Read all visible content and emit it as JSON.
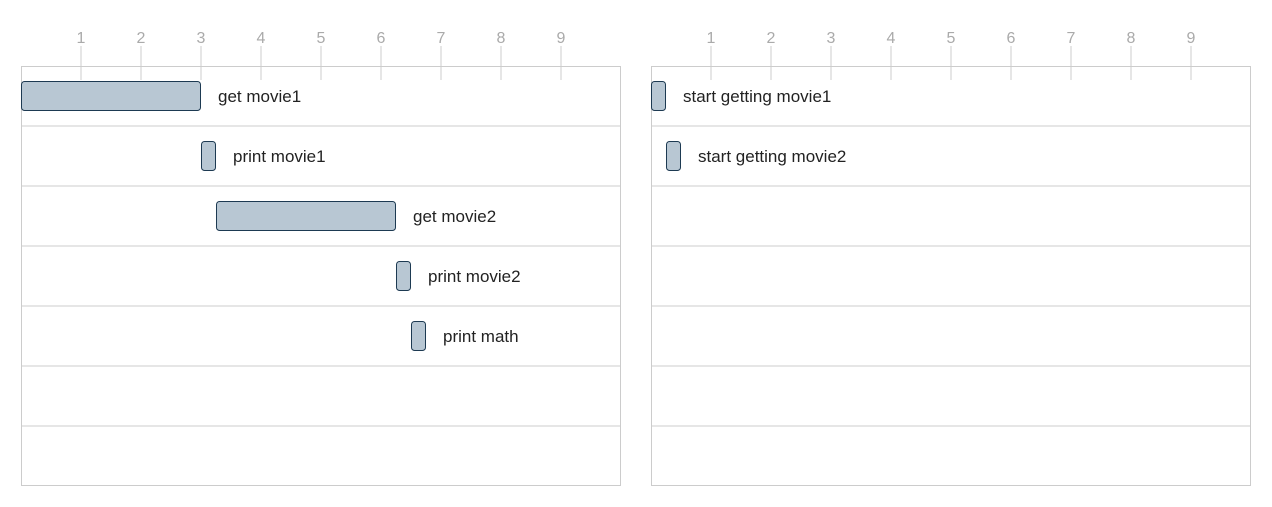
{
  "chart_data": [
    {
      "type": "gantt",
      "axis_ticks": [
        1,
        2,
        3,
        4,
        5,
        6,
        7,
        8,
        9
      ],
      "xlim": [
        0,
        10
      ],
      "row_count": 7,
      "tasks": [
        {
          "label": "get movie1",
          "start": 0,
          "end": 3,
          "row": 0
        },
        {
          "label": "print movie1",
          "start": 3,
          "end": 3.25,
          "row": 1
        },
        {
          "label": "get movie2",
          "start": 3.25,
          "end": 6.25,
          "row": 2
        },
        {
          "label": "print movie2",
          "start": 6.25,
          "end": 6.5,
          "row": 3
        },
        {
          "label": "print math",
          "start": 6.5,
          "end": 6.75,
          "row": 4
        }
      ]
    },
    {
      "type": "gantt",
      "axis_ticks": [
        1,
        2,
        3,
        4,
        5,
        6,
        7,
        8,
        9
      ],
      "xlim": [
        0,
        10
      ],
      "row_count": 7,
      "tasks": [
        {
          "label": "start getting movie1",
          "start": 0,
          "end": 0.25,
          "row": 0
        },
        {
          "label": "start getting movie2",
          "start": 0.25,
          "end": 0.5,
          "row": 1
        }
      ]
    }
  ],
  "colors": {
    "bar_fill": "#b8c7d3",
    "bar_stroke": "#1d3a52",
    "grid": "#cccccc",
    "tick_text": "#aaaaaa",
    "label_text": "#222222"
  }
}
